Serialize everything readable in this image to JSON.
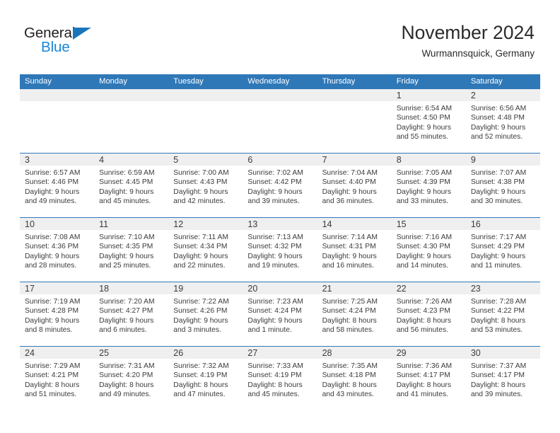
{
  "logo": {
    "word_one": "General",
    "word_two": "Blue",
    "triangle_icon": "logo-triangle-icon",
    "accent_dark": "#231f20",
    "accent_blue": "#1b86d6"
  },
  "header": {
    "title": "November 2024",
    "subtitle": "Wurmannsquick, Germany",
    "header_bg": "#2f78b8",
    "daynum_bg": "#efefef"
  },
  "weekday_headers": [
    "Sunday",
    "Monday",
    "Tuesday",
    "Wednesday",
    "Thursday",
    "Friday",
    "Saturday"
  ],
  "weeks": [
    [
      {
        "day": "",
        "lines": []
      },
      {
        "day": "",
        "lines": []
      },
      {
        "day": "",
        "lines": []
      },
      {
        "day": "",
        "lines": []
      },
      {
        "day": "",
        "lines": []
      },
      {
        "day": "1",
        "lines": [
          "Sunrise: 6:54 AM",
          "Sunset: 4:50 PM",
          "Daylight: 9 hours",
          "and 55 minutes."
        ]
      },
      {
        "day": "2",
        "lines": [
          "Sunrise: 6:56 AM",
          "Sunset: 4:48 PM",
          "Daylight: 9 hours",
          "and 52 minutes."
        ]
      }
    ],
    [
      {
        "day": "3",
        "lines": [
          "Sunrise: 6:57 AM",
          "Sunset: 4:46 PM",
          "Daylight: 9 hours",
          "and 49 minutes."
        ]
      },
      {
        "day": "4",
        "lines": [
          "Sunrise: 6:59 AM",
          "Sunset: 4:45 PM",
          "Daylight: 9 hours",
          "and 45 minutes."
        ]
      },
      {
        "day": "5",
        "lines": [
          "Sunrise: 7:00 AM",
          "Sunset: 4:43 PM",
          "Daylight: 9 hours",
          "and 42 minutes."
        ]
      },
      {
        "day": "6",
        "lines": [
          "Sunrise: 7:02 AM",
          "Sunset: 4:42 PM",
          "Daylight: 9 hours",
          "and 39 minutes."
        ]
      },
      {
        "day": "7",
        "lines": [
          "Sunrise: 7:04 AM",
          "Sunset: 4:40 PM",
          "Daylight: 9 hours",
          "and 36 minutes."
        ]
      },
      {
        "day": "8",
        "lines": [
          "Sunrise: 7:05 AM",
          "Sunset: 4:39 PM",
          "Daylight: 9 hours",
          "and 33 minutes."
        ]
      },
      {
        "day": "9",
        "lines": [
          "Sunrise: 7:07 AM",
          "Sunset: 4:38 PM",
          "Daylight: 9 hours",
          "and 30 minutes."
        ]
      }
    ],
    [
      {
        "day": "10",
        "lines": [
          "Sunrise: 7:08 AM",
          "Sunset: 4:36 PM",
          "Daylight: 9 hours",
          "and 28 minutes."
        ]
      },
      {
        "day": "11",
        "lines": [
          "Sunrise: 7:10 AM",
          "Sunset: 4:35 PM",
          "Daylight: 9 hours",
          "and 25 minutes."
        ]
      },
      {
        "day": "12",
        "lines": [
          "Sunrise: 7:11 AM",
          "Sunset: 4:34 PM",
          "Daylight: 9 hours",
          "and 22 minutes."
        ]
      },
      {
        "day": "13",
        "lines": [
          "Sunrise: 7:13 AM",
          "Sunset: 4:32 PM",
          "Daylight: 9 hours",
          "and 19 minutes."
        ]
      },
      {
        "day": "14",
        "lines": [
          "Sunrise: 7:14 AM",
          "Sunset: 4:31 PM",
          "Daylight: 9 hours",
          "and 16 minutes."
        ]
      },
      {
        "day": "15",
        "lines": [
          "Sunrise: 7:16 AM",
          "Sunset: 4:30 PM",
          "Daylight: 9 hours",
          "and 14 minutes."
        ]
      },
      {
        "day": "16",
        "lines": [
          "Sunrise: 7:17 AM",
          "Sunset: 4:29 PM",
          "Daylight: 9 hours",
          "and 11 minutes."
        ]
      }
    ],
    [
      {
        "day": "17",
        "lines": [
          "Sunrise: 7:19 AM",
          "Sunset: 4:28 PM",
          "Daylight: 9 hours",
          "and 8 minutes."
        ]
      },
      {
        "day": "18",
        "lines": [
          "Sunrise: 7:20 AM",
          "Sunset: 4:27 PM",
          "Daylight: 9 hours",
          "and 6 minutes."
        ]
      },
      {
        "day": "19",
        "lines": [
          "Sunrise: 7:22 AM",
          "Sunset: 4:26 PM",
          "Daylight: 9 hours",
          "and 3 minutes."
        ]
      },
      {
        "day": "20",
        "lines": [
          "Sunrise: 7:23 AM",
          "Sunset: 4:24 PM",
          "Daylight: 9 hours",
          "and 1 minute."
        ]
      },
      {
        "day": "21",
        "lines": [
          "Sunrise: 7:25 AM",
          "Sunset: 4:24 PM",
          "Daylight: 8 hours",
          "and 58 minutes."
        ]
      },
      {
        "day": "22",
        "lines": [
          "Sunrise: 7:26 AM",
          "Sunset: 4:23 PM",
          "Daylight: 8 hours",
          "and 56 minutes."
        ]
      },
      {
        "day": "23",
        "lines": [
          "Sunrise: 7:28 AM",
          "Sunset: 4:22 PM",
          "Daylight: 8 hours",
          "and 53 minutes."
        ]
      }
    ],
    [
      {
        "day": "24",
        "lines": [
          "Sunrise: 7:29 AM",
          "Sunset: 4:21 PM",
          "Daylight: 8 hours",
          "and 51 minutes."
        ]
      },
      {
        "day": "25",
        "lines": [
          "Sunrise: 7:31 AM",
          "Sunset: 4:20 PM",
          "Daylight: 8 hours",
          "and 49 minutes."
        ]
      },
      {
        "day": "26",
        "lines": [
          "Sunrise: 7:32 AM",
          "Sunset: 4:19 PM",
          "Daylight: 8 hours",
          "and 47 minutes."
        ]
      },
      {
        "day": "27",
        "lines": [
          "Sunrise: 7:33 AM",
          "Sunset: 4:19 PM",
          "Daylight: 8 hours",
          "and 45 minutes."
        ]
      },
      {
        "day": "28",
        "lines": [
          "Sunrise: 7:35 AM",
          "Sunset: 4:18 PM",
          "Daylight: 8 hours",
          "and 43 minutes."
        ]
      },
      {
        "day": "29",
        "lines": [
          "Sunrise: 7:36 AM",
          "Sunset: 4:17 PM",
          "Daylight: 8 hours",
          "and 41 minutes."
        ]
      },
      {
        "day": "30",
        "lines": [
          "Sunrise: 7:37 AM",
          "Sunset: 4:17 PM",
          "Daylight: 8 hours",
          "and 39 minutes."
        ]
      }
    ]
  ]
}
